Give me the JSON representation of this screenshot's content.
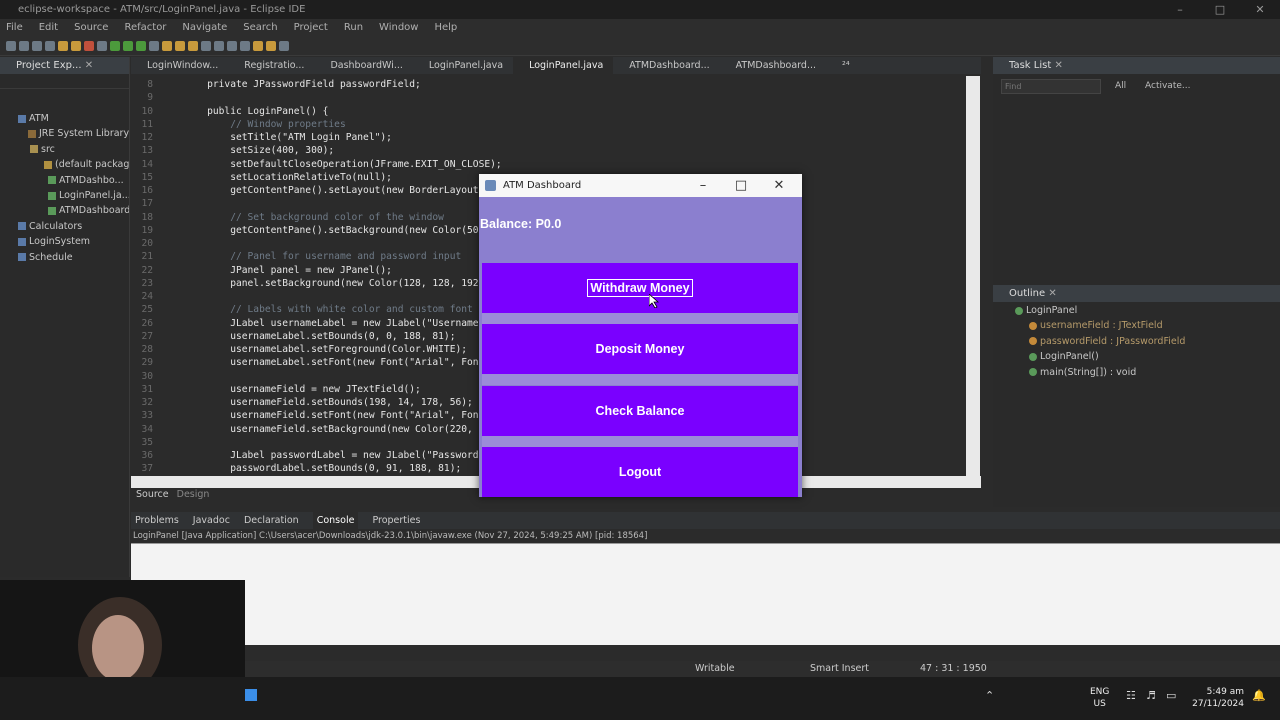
{
  "window": {
    "title": "eclipse-workspace - ATM/src/LoginPanel.java - Eclipse IDE"
  },
  "menu": [
    "File",
    "Edit",
    "Source",
    "Refactor",
    "Navigate",
    "Search",
    "Project",
    "Run",
    "Window",
    "Help"
  ],
  "project_explorer": {
    "title": "Project Exp...",
    "items": [
      "ATM",
      "JRE System Library",
      "src",
      "(default package)",
      "ATMDashbo...",
      "LoginPanel.ja...",
      "ATMDashboard...",
      "Calculators",
      "LoginSystem",
      "Schedule"
    ]
  },
  "editor_tabs": [
    "LoginWindow...",
    "Registratio...",
    "DashboardWi...",
    "LoginPanel.java",
    "LoginPanel.java",
    "ATMDashboard...",
    "ATMDashboard...",
    "²⁴"
  ],
  "code_lines": [
    {
      "n": "8",
      "t": "    private JPasswordField passwordField;"
    },
    {
      "n": "9",
      "t": ""
    },
    {
      "n": "10",
      "t": "    public LoginPanel() {"
    },
    {
      "n": "11",
      "t": "        // Window properties"
    },
    {
      "n": "12",
      "t": "        setTitle(\"ATM Login Panel\");"
    },
    {
      "n": "13",
      "t": "        setSize(400, 300);"
    },
    {
      "n": "14",
      "t": "        setDefaultCloseOperation(JFrame.EXIT_ON_CLOSE);"
    },
    {
      "n": "15",
      "t": "        setLocationRelativeTo(null);"
    },
    {
      "n": "16",
      "t": "        getContentPane().setLayout(new BorderLayout());"
    },
    {
      "n": "17",
      "t": ""
    },
    {
      "n": "18",
      "t": "        // Set background color of the window"
    },
    {
      "n": "19",
      "t": "        getContentPane().setBackground(new Color(50,"
    },
    {
      "n": "20",
      "t": ""
    },
    {
      "n": "21",
      "t": "        // Panel for username and password input"
    },
    {
      "n": "22",
      "t": "        JPanel panel = new JPanel();"
    },
    {
      "n": "23",
      "t": "        panel.setBackground(new Color(128, 128, 192));"
    },
    {
      "n": "24",
      "t": ""
    },
    {
      "n": "25",
      "t": "        // Labels with white color and custom font"
    },
    {
      "n": "26",
      "t": "        JLabel usernameLabel = new JLabel(\"Username:\""
    },
    {
      "n": "27",
      "t": "        usernameLabel.setBounds(0, 0, 188, 81);"
    },
    {
      "n": "28",
      "t": "        usernameLabel.setForeground(Color.WHITE);"
    },
    {
      "n": "29",
      "t": "        usernameLabel.setFont(new Font(\"Arial\", Font."
    },
    {
      "n": "30",
      "t": ""
    },
    {
      "n": "31",
      "t": "        usernameField = new JTextField();"
    },
    {
      "n": "32",
      "t": "        usernameField.setBounds(198, 14, 178, 56);"
    },
    {
      "n": "33",
      "t": "        usernameField.setFont(new Font(\"Arial\", Font."
    },
    {
      "n": "34",
      "t": "        usernameField.setBackground(new Color(220, 22"
    },
    {
      "n": "35",
      "t": ""
    },
    {
      "n": "36",
      "t": "        JLabel passwordLabel = new JLabel(\"Password:\""
    },
    {
      "n": "37",
      "t": "        passwordLabel.setBounds(0, 91, 188, 81);"
    }
  ],
  "source_tabs": [
    "Source",
    "Design"
  ],
  "task_list": {
    "title": "Task List",
    "find_placeholder": "Find",
    "all": "All",
    "activate": "Activate..."
  },
  "outline": {
    "title": "Outline",
    "items": [
      "LoginPanel",
      "usernameField : JTextField",
      "passwordField : JPasswordField",
      "LoginPanel()",
      "main(String[]) : void"
    ]
  },
  "bottom_tabs": [
    "Problems",
    "Javadoc",
    "Declaration",
    "Console",
    "Properties"
  ],
  "console_launch": "LoginPanel [Java Application] C:\\Users\\acer\\Downloads\\jdk-23.0.1\\bin\\javaw.exe (Nov 27, 2024, 5:49:25 AM) [pid: 18564]",
  "status": {
    "writable": "Writable",
    "insert": "Smart Insert",
    "position": "47 : 31 : 1950"
  },
  "dialog": {
    "title": "ATM Dashboard",
    "balance": "Balance: P0.0",
    "buttons": [
      "Withdraw Money",
      "Deposit Money",
      "Check Balance",
      "Logout"
    ],
    "bg_color": "#8b7fcf",
    "button_color": "#7a00ff"
  },
  "taskbar": {
    "lang": "ENG",
    "region": "US",
    "time": "5:49 am",
    "date": "27/11/2024"
  }
}
